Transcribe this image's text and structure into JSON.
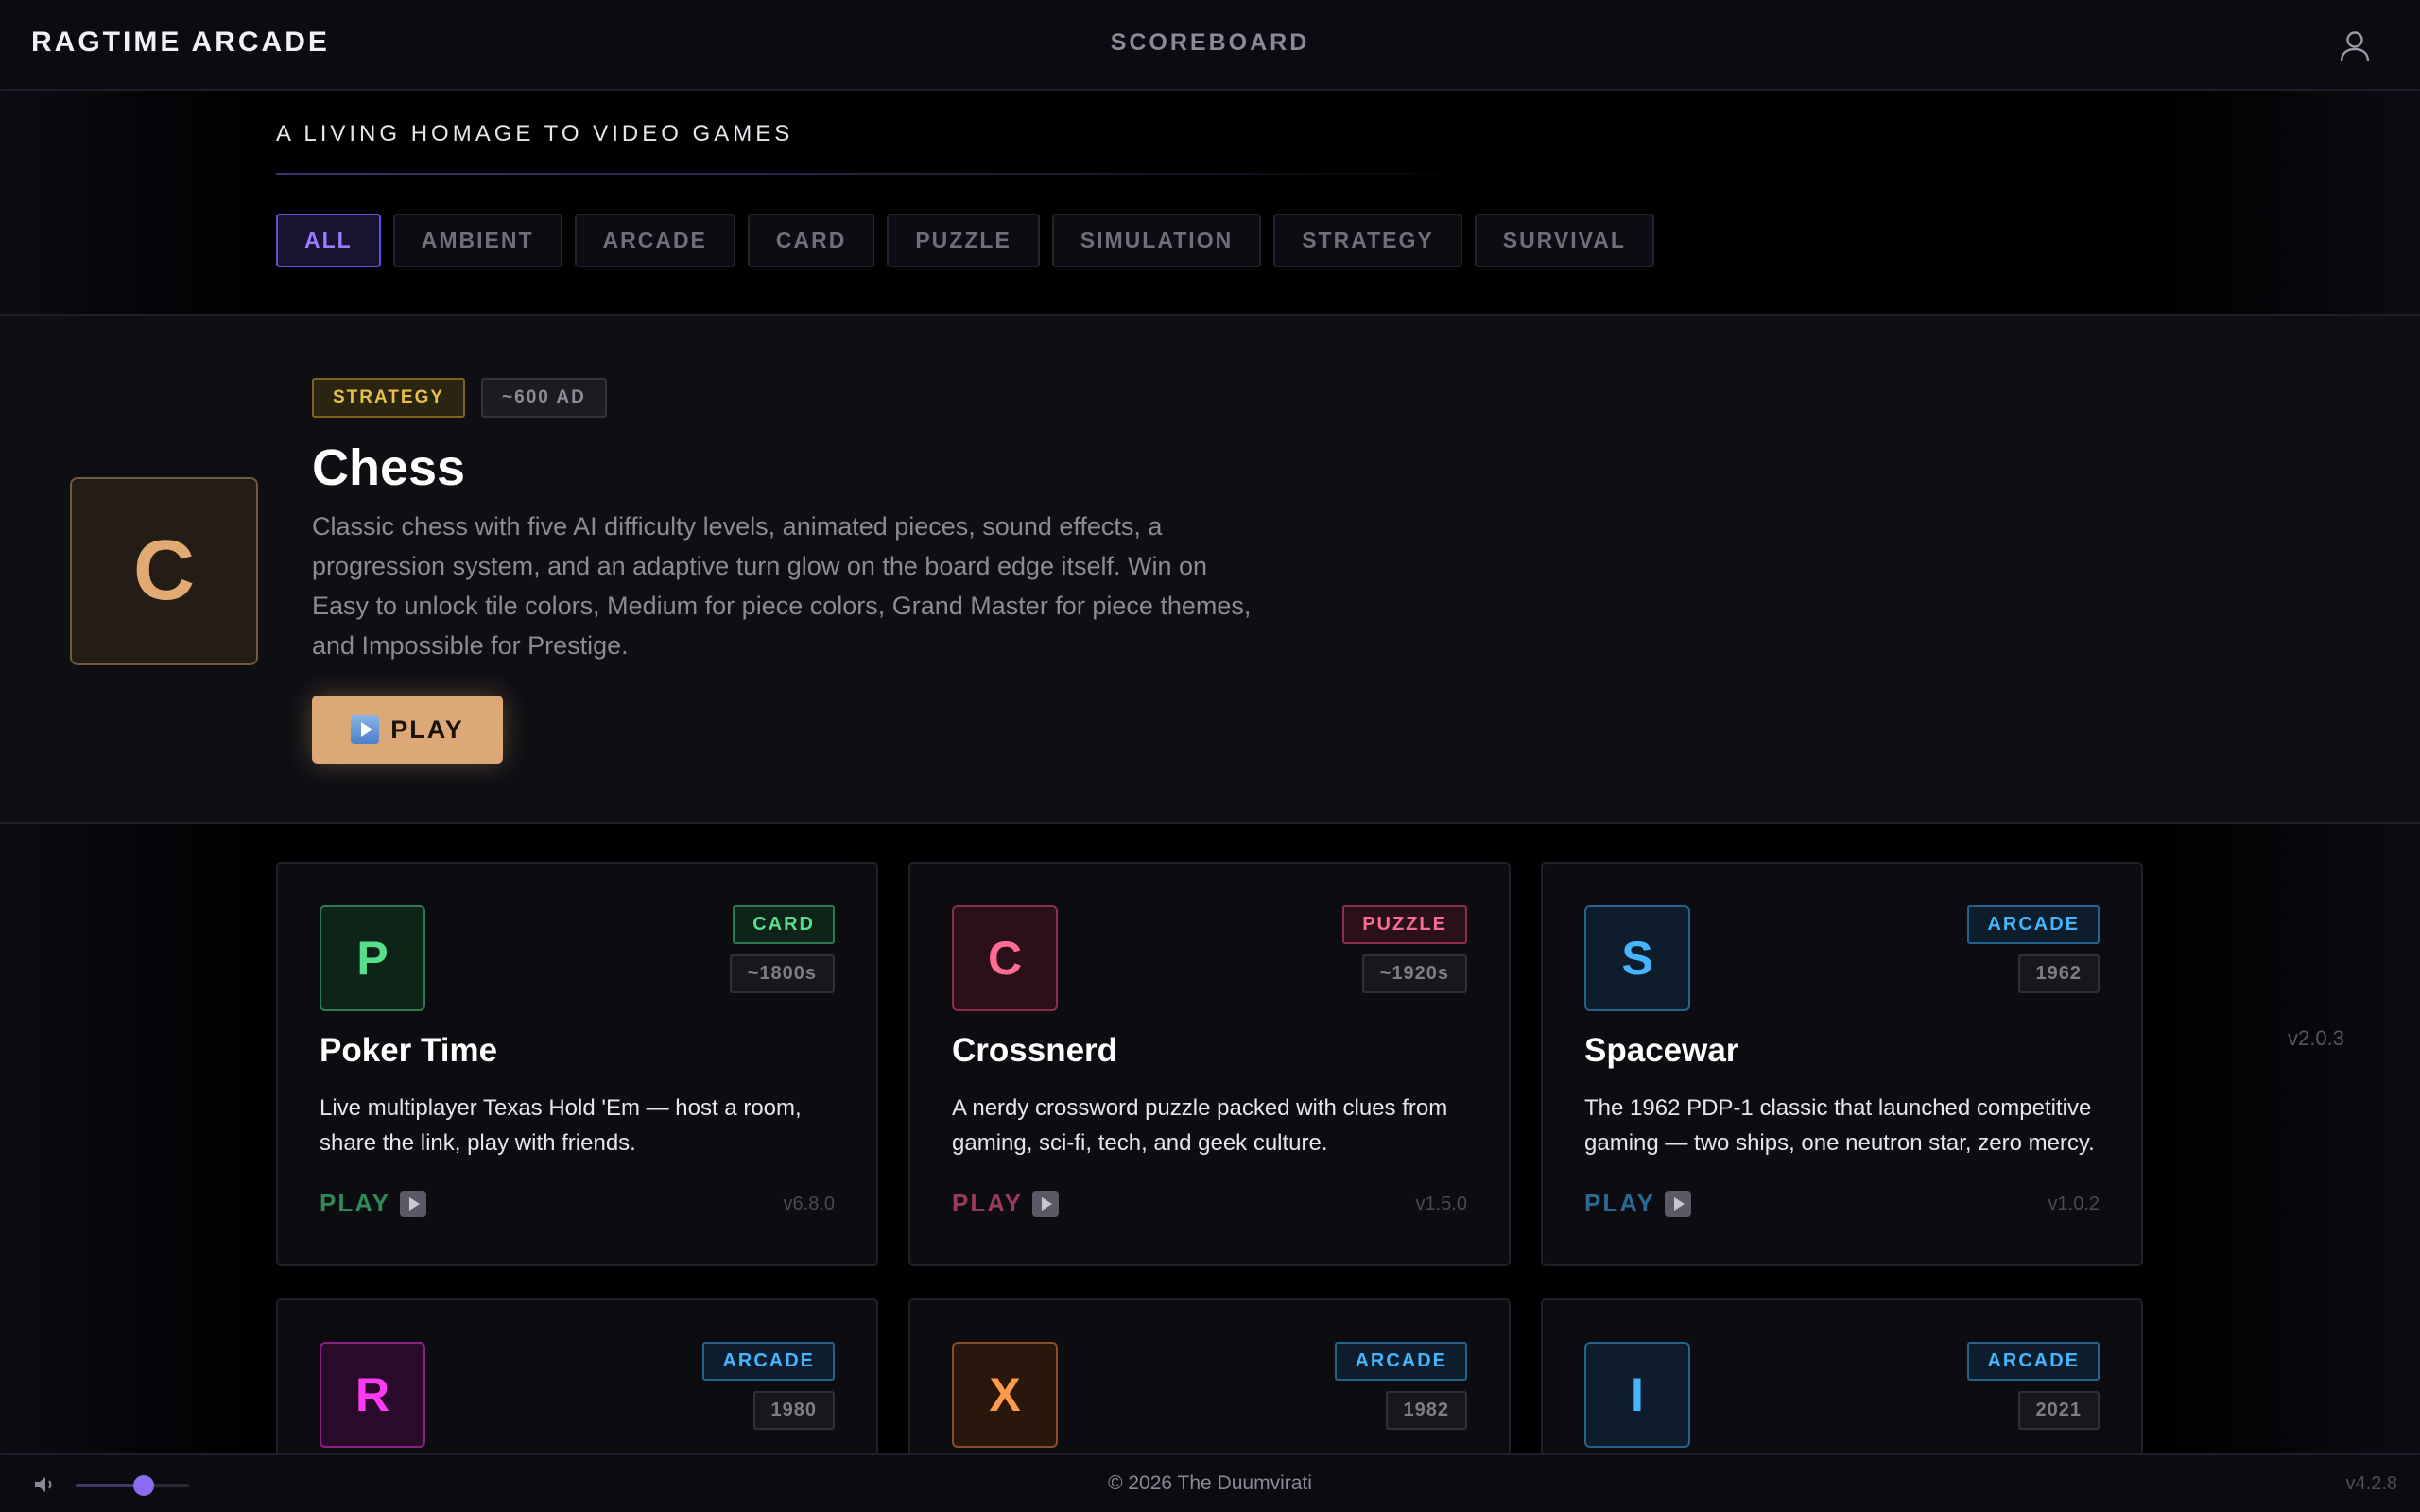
{
  "header": {
    "brand": "RAGTIME ARCADE",
    "nav_scoreboard": "SCOREBOARD",
    "user_icon": "user-icon"
  },
  "tagline": "A LIVING HOMAGE TO VIDEO GAMES",
  "filters": [
    "ALL",
    "AMBIENT",
    "ARCADE",
    "CARD",
    "PUZZLE",
    "SIMULATION",
    "STRATEGY",
    "SURVIVAL"
  ],
  "active_filter": "ALL",
  "featured": {
    "letter": "C",
    "category": "STRATEGY",
    "era": "~600 AD",
    "title": "Chess",
    "description": "Classic chess with five AI difficulty levels, animated pieces, sound effects, a progression system, and an adaptive turn glow on the board edge itself. Win on Easy to unlock tile colors, Medium for piece colors, Grand Master for piece themes, and Impossible for Prestige.",
    "play_label": "PLAY",
    "play_icon": "play-button-icon",
    "version": "v2.0.3",
    "accent": "#dca877"
  },
  "games": [
    {
      "letter": "P",
      "category": "CARD",
      "era": "~1800s",
      "title": "Poker Time",
      "description": "Live multiplayer Texas Hold 'Em — host a room, share the link, play with friends.",
      "play_label": "PLAY",
      "version": "v6.8.0",
      "accent": "#56e08c"
    },
    {
      "letter": "C",
      "category": "PUZZLE",
      "era": "~1920s",
      "title": "Crossnerd",
      "description": "A nerdy crossword puzzle packed with clues from gaming, sci-fi, tech, and geek culture.",
      "play_label": "PLAY",
      "version": "v1.5.0",
      "accent": "#ff6b95"
    },
    {
      "letter": "S",
      "category": "ARCADE",
      "era": "1962",
      "title": "Spacewar",
      "description": "The 1962 PDP-1 classic that launched competitive gaming — two ships, one neutron star, zero mercy.",
      "play_label": "PLAY",
      "version": "v1.0.2",
      "accent": "#46b4ff"
    },
    {
      "letter": "R",
      "category": "ARCADE",
      "era": "1980",
      "accent": "#ff3af4"
    },
    {
      "letter": "X",
      "category": "ARCADE",
      "era": "1982",
      "accent": "#ff9a4d"
    },
    {
      "letter": "I",
      "category": "ARCADE",
      "era": "2021",
      "accent": "#46b4ff"
    }
  ],
  "footer": {
    "volume_icon": "speaker-icon",
    "volume_level": 0.6,
    "copyright": "© 2026 The Duumvirati",
    "app_version": "v4.2.8"
  },
  "colors": {
    "background": "#000000",
    "active_filter": "#9b7bff",
    "slider_knob": "#8a6cf0"
  }
}
